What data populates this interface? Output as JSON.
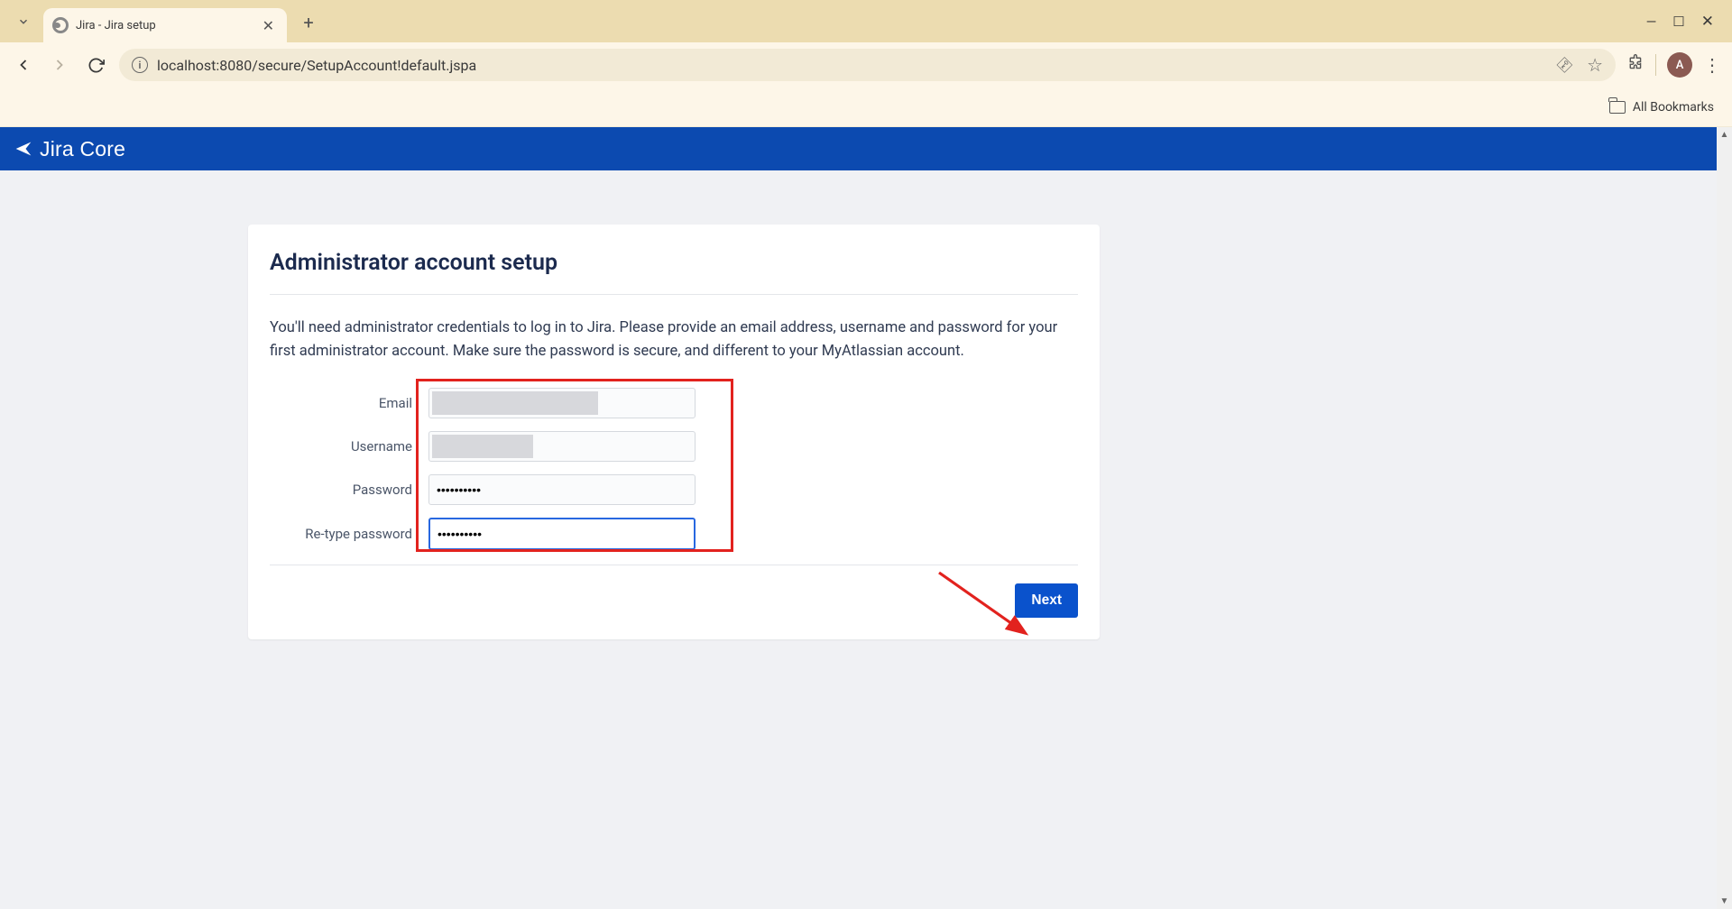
{
  "browser": {
    "tab_title": "Jira - Jira setup",
    "url_display": "localhost:8080/secure/SetupAccount!default.jspa",
    "url_host": "localhost",
    "avatar_letter": "A",
    "bookmarks_label": "All Bookmarks"
  },
  "app": {
    "product_name": "Jira Core"
  },
  "page": {
    "heading": "Administrator account setup",
    "description": "You'll need administrator credentials to log in to Jira. Please provide an email address, username and password for your first administrator account. Make sure the password is secure, and different to your MyAtlassian account."
  },
  "form": {
    "fields": {
      "email": {
        "label": "Email",
        "value": ""
      },
      "username": {
        "label": "Username",
        "value": ""
      },
      "password": {
        "label": "Password",
        "value": "••••••••••"
      },
      "retype_password": {
        "label": "Re-type password",
        "value": "••••••••••"
      }
    },
    "submit_label": "Next"
  }
}
